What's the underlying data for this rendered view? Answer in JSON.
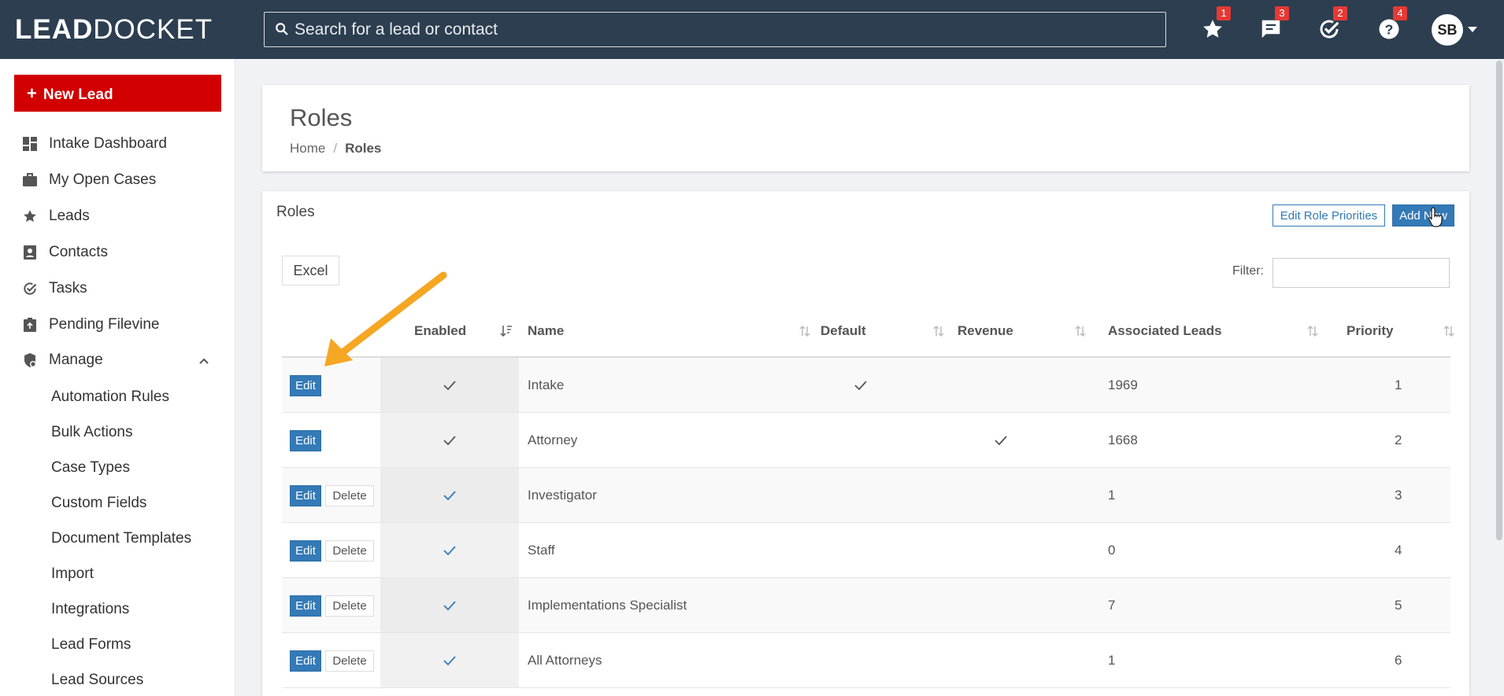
{
  "app": {
    "logo_bold": "LEAD",
    "logo_thin": "DOCKET"
  },
  "topbar": {
    "search_placeholder": "Search for a lead or contact",
    "icons": [
      {
        "name": "star-icon",
        "badge": "1"
      },
      {
        "name": "chat-icon",
        "badge": "3"
      },
      {
        "name": "tasks-check-icon",
        "badge": "2"
      },
      {
        "name": "help-icon",
        "badge": "4"
      }
    ],
    "avatar_initials": "SB"
  },
  "sidebar": {
    "new_lead_label": "New Lead",
    "items": [
      {
        "label": "Intake Dashboard",
        "icon": "dashboard-icon"
      },
      {
        "label": "My Open Cases",
        "icon": "briefcase-icon"
      },
      {
        "label": "Leads",
        "icon": "star-icon"
      },
      {
        "label": "Contacts",
        "icon": "contacts-icon"
      },
      {
        "label": "Tasks",
        "icon": "check-circle-icon"
      },
      {
        "label": "Pending Filevine",
        "icon": "filevine-icon"
      },
      {
        "label": "Manage",
        "icon": "manage-shield-icon"
      }
    ],
    "manage_subitems": [
      "Automation Rules",
      "Bulk Actions",
      "Case Types",
      "Custom Fields",
      "Document Templates",
      "Import",
      "Integrations",
      "Lead Forms",
      "Lead Sources"
    ]
  },
  "header": {
    "title": "Roles",
    "breadcrumb_home": "Home",
    "breadcrumb_sep": "/",
    "breadcrumb_current": "Roles"
  },
  "roles_panel": {
    "title": "Roles",
    "edit_priorities_label": "Edit Role Priorities",
    "add_new_label": "Add New",
    "excel_label": "Excel",
    "filter_label": "Filter:",
    "filter_value": ""
  },
  "table": {
    "columns": [
      "Enabled",
      "Name",
      "Default",
      "Revenue",
      "Associated Leads",
      "Priority"
    ],
    "edit_label": "Edit",
    "delete_label": "Delete",
    "rows": [
      {
        "name": "Intake",
        "enabled": true,
        "enabled_color": "#555555",
        "default": true,
        "revenue": false,
        "associated_leads": "1969",
        "priority": "1",
        "deletable": false
      },
      {
        "name": "Attorney",
        "enabled": true,
        "enabled_color": "#555555",
        "default": false,
        "revenue": true,
        "associated_leads": "1668",
        "priority": "2",
        "deletable": false
      },
      {
        "name": "Investigator",
        "enabled": true,
        "enabled_color": "#337ab7",
        "default": false,
        "revenue": false,
        "associated_leads": "1",
        "priority": "3",
        "deletable": true
      },
      {
        "name": "Staff",
        "enabled": true,
        "enabled_color": "#337ab7",
        "default": false,
        "revenue": false,
        "associated_leads": "0",
        "priority": "4",
        "deletable": true
      },
      {
        "name": "Implementations Specialist",
        "enabled": true,
        "enabled_color": "#337ab7",
        "default": false,
        "revenue": false,
        "associated_leads": "7",
        "priority": "5",
        "deletable": true
      },
      {
        "name": "All Attorneys",
        "enabled": true,
        "enabled_color": "#337ab7",
        "default": false,
        "revenue": false,
        "associated_leads": "1",
        "priority": "6",
        "deletable": true
      }
    ]
  },
  "colors": {
    "topbar": "#2c3e50",
    "new_lead": "#d20000",
    "primary": "#337ab7",
    "badge": "#e53935",
    "annotation_arrow": "#f5a623"
  }
}
